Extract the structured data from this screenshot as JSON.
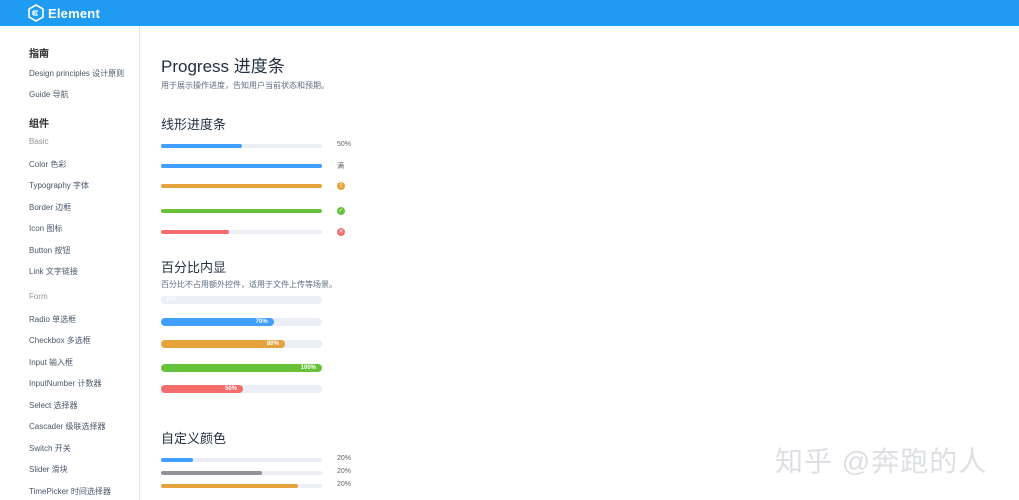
{
  "header": {
    "brand": "Element",
    "accent": "#1f9bf2"
  },
  "sidebar": {
    "guide_title": "指南",
    "guide_items": [
      "Design principles 设计原则",
      "Guide 导航"
    ],
    "components_title": "组件",
    "basic_label": "Basic",
    "basic_items": [
      "Color 色彩",
      "Typography 字体",
      "Border 边框",
      "Icon 图标",
      "Button 按钮",
      "Link 文字链接"
    ],
    "form_label": "Form",
    "form_items": [
      "Radio 单选框",
      "Checkbox 多选框",
      "Input 输入框",
      "InputNumber 计数器",
      "Select 选择器",
      "Cascader 级联选择器",
      "Switch 开关",
      "Slider 滑块",
      "TimePicker 时间选择器"
    ]
  },
  "page": {
    "title": "Progress 进度条",
    "description": "用于展示操作进度，告知用户当前状态和预期。"
  },
  "linear": {
    "title": "线形进度条",
    "bars": [
      {
        "percent": 50,
        "color": "#409eff",
        "label": "50%",
        "status": "text"
      },
      {
        "percent": 100,
        "color": "#409eff",
        "label": "满",
        "status": "text"
      },
      {
        "percent": 100,
        "color": "#e6a23c",
        "label": "!",
        "status": "warning"
      },
      {
        "percent": 100,
        "color": "#67c23a",
        "label": "✓",
        "status": "success"
      },
      {
        "percent": 42,
        "color": "#f56c6c",
        "label": "✕",
        "status": "exception"
      }
    ]
  },
  "inside": {
    "title": "百分比内显",
    "description": "百分比不占用额外控件，适用于文件上传等场景。",
    "bars": [
      {
        "percent": 0,
        "color": "#409eff",
        "label": "0%"
      },
      {
        "percent": 70,
        "color": "#409eff",
        "label": "70%"
      },
      {
        "percent": 77,
        "color": "#e6a23c",
        "label": "80%"
      },
      {
        "percent": 100,
        "color": "#67c23a",
        "label": "100%"
      },
      {
        "percent": 51,
        "color": "#f56c6c",
        "label": "50%"
      }
    ]
  },
  "custom": {
    "title": "自定义颜色",
    "bars": [
      {
        "percent": 20,
        "color": "#409eff",
        "label": "20%"
      },
      {
        "percent": 63,
        "color": "#909399",
        "label": "20%"
      },
      {
        "percent": 85,
        "color": "#e6a23c",
        "label": "20%"
      }
    ]
  },
  "watermark": "知乎 @奔跑的人"
}
